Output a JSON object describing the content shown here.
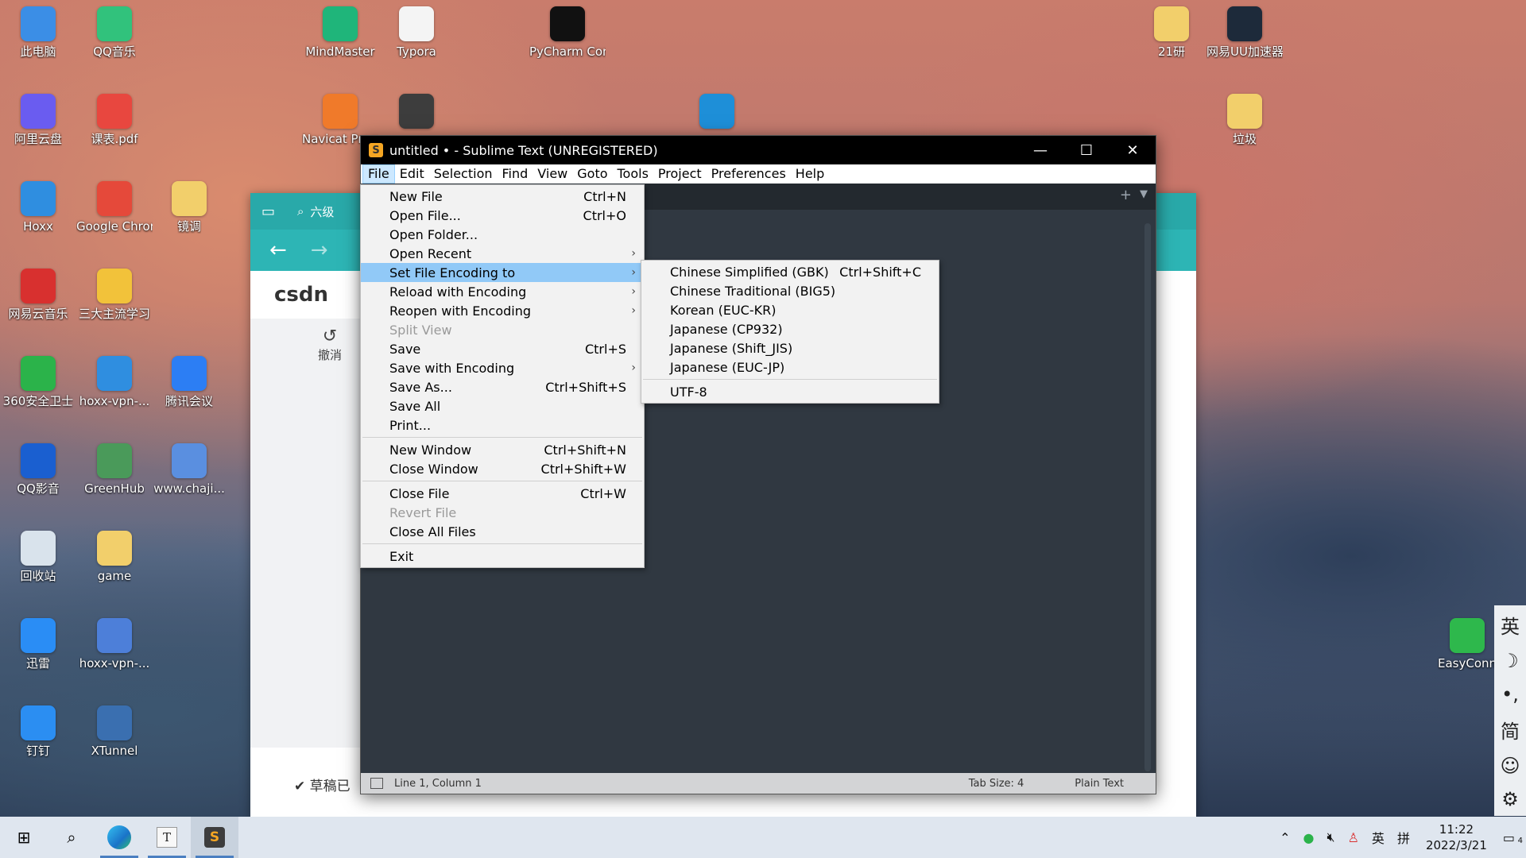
{
  "desktop": {
    "icons": [
      {
        "label": "此电脑",
        "icon": "computer-icon",
        "color": "#3b8ee6"
      },
      {
        "label": "QQ音乐",
        "icon": "qq-music-icon",
        "color": "#31c27c"
      },
      {
        "label": "MindMaster",
        "icon": "mindmaster-icon",
        "color": "#1fb57a"
      },
      {
        "label": "Typora",
        "icon": "typora-icon",
        "color": "#f4f4f4"
      },
      {
        "label": "PyCharm Communi...",
        "icon": "pycharm-icon",
        "color": "#111111"
      },
      {
        "label": "21研",
        "icon": "folder-icon",
        "color": "#f2cf6b"
      },
      {
        "label": "网易UU加速器",
        "icon": "uu-accelerator-icon",
        "color": "#1d2a3a"
      },
      {
        "label": "阿里云盘",
        "icon": "aliyun-drive-icon",
        "color": "#6a5cf0"
      },
      {
        "label": "课表.pdf",
        "icon": "pdf-icon",
        "color": "#e8473f"
      },
      {
        "label": "Navicat Premium",
        "icon": "navicat-icon",
        "color": "#f07a2a"
      },
      {
        "label": "",
        "icon": "sublime-icon",
        "color": "#3d3d3d"
      },
      {
        "label": "",
        "icon": "edge-icon",
        "color": "#1e8fd8"
      },
      {
        "label": "垃圾",
        "icon": "folder-icon",
        "color": "#f2cf6b"
      },
      {
        "label": "Hoxx",
        "icon": "hoxx-icon",
        "color": "#2f8ee0"
      },
      {
        "label": "Google Chrome",
        "icon": "chrome-icon",
        "color": "#e5493a"
      },
      {
        "label": "镜调",
        "icon": "folder-icon",
        "color": "#f2cf6b"
      },
      {
        "label": "网易云音乐",
        "icon": "netease-music-icon",
        "color": "#d8302f"
      },
      {
        "label": "三大主流学习",
        "icon": "archive-icon",
        "color": "#f2c23a"
      },
      {
        "label": "360安全卫士",
        "icon": "360-icon",
        "color": "#2bb34a"
      },
      {
        "label": "hoxx-vpn-...",
        "icon": "hoxx-icon",
        "color": "#2f8ee0"
      },
      {
        "label": "腾讯会议",
        "icon": "tencent-meeting-icon",
        "color": "#2c7ef4"
      },
      {
        "label": "QQ影音",
        "icon": "qq-player-icon",
        "color": "#1a5fd0"
      },
      {
        "label": "GreenHub",
        "icon": "greenhub-icon",
        "color": "#4a9a5a"
      },
      {
        "label": "www.chaji...",
        "icon": "archive-icon",
        "color": "#5a8fe0"
      },
      {
        "label": "回收站",
        "icon": "recycle-bin-icon",
        "color": "#d9e3ec"
      },
      {
        "label": "game",
        "icon": "folder-icon",
        "color": "#f2cf6b"
      },
      {
        "label": "迅雷",
        "icon": "thunder-icon",
        "color": "#2a8df5"
      },
      {
        "label": "hoxx-vpn-...",
        "icon": "archive-icon",
        "color": "#4d7fd9"
      },
      {
        "label": "钉钉",
        "icon": "dingtalk-icon",
        "color": "#2b8ef2"
      },
      {
        "label": "XTunnel",
        "icon": "xtunnel-icon",
        "color": "#3a6fb0"
      },
      {
        "label": "EasyConn",
        "icon": "easyconnect-icon",
        "color": "#2eb84c"
      }
    ]
  },
  "browser": {
    "search_text": "六级",
    "logo": "csdn",
    "undo_label": "撤消",
    "draft_text": "草稿已"
  },
  "sublime": {
    "title": "untitled • - Sublime Text (UNREGISTERED)",
    "menubar": [
      "File",
      "Edit",
      "Selection",
      "Find",
      "View",
      "Goto",
      "Tools",
      "Project",
      "Preferences",
      "Help"
    ],
    "status": {
      "position": "Line 1, Column 1",
      "tab_size": "Tab Size: 4",
      "syntax": "Plain Text"
    }
  },
  "file_menu": {
    "groups": [
      [
        {
          "label": "New File",
          "shortcut": "Ctrl+N"
        },
        {
          "label": "Open File...",
          "shortcut": "Ctrl+O"
        },
        {
          "label": "Open Folder...",
          "shortcut": ""
        },
        {
          "label": "Open Recent",
          "shortcut": "",
          "submenu": true
        },
        {
          "label": "Set File Encoding to",
          "shortcut": "",
          "submenu": true,
          "highlighted": true
        },
        {
          "label": "Reload with Encoding",
          "shortcut": "",
          "submenu": true
        },
        {
          "label": "Reopen with Encoding",
          "shortcut": "",
          "submenu": true
        },
        {
          "label": "Split View",
          "shortcut": "",
          "disabled": true
        },
        {
          "label": "Save",
          "shortcut": "Ctrl+S"
        },
        {
          "label": "Save with Encoding",
          "shortcut": "",
          "submenu": true
        },
        {
          "label": "Save As...",
          "shortcut": "Ctrl+Shift+S"
        },
        {
          "label": "Save All",
          "shortcut": ""
        },
        {
          "label": "Print...",
          "shortcut": ""
        }
      ],
      [
        {
          "label": "New Window",
          "shortcut": "Ctrl+Shift+N"
        },
        {
          "label": "Close Window",
          "shortcut": "Ctrl+Shift+W"
        }
      ],
      [
        {
          "label": "Close File",
          "shortcut": "Ctrl+W"
        },
        {
          "label": "Revert File",
          "shortcut": "",
          "disabled": true
        },
        {
          "label": "Close All Files",
          "shortcut": ""
        }
      ],
      [
        {
          "label": "Exit",
          "shortcut": ""
        }
      ]
    ]
  },
  "encoding_menu": {
    "items": [
      {
        "label": "Chinese Simplified (GBK)",
        "shortcut": "Ctrl+Shift+C"
      },
      {
        "label": "Chinese Traditional (BIG5)",
        "shortcut": ""
      },
      {
        "label": "Korean (EUC-KR)",
        "shortcut": ""
      },
      {
        "label": "Japanese (CP932)",
        "shortcut": ""
      },
      {
        "label": "Japanese (Shift_JIS)",
        "shortcut": ""
      },
      {
        "label": "Japanese (EUC-JP)",
        "shortcut": ""
      }
    ],
    "after_separator": [
      {
        "label": "UTF-8",
        "shortcut": ""
      }
    ]
  },
  "ime_panel": [
    "英",
    "☽",
    "•,",
    "简",
    "☺",
    "⚙"
  ],
  "taskbar": {
    "apps": [
      "start-icon",
      "search-icon",
      "edge-icon",
      "typora-icon",
      "sublime-icon"
    ],
    "tray": {
      "ime_lang": "英",
      "ime_mode": "拼",
      "time": "11:22",
      "date": "2022/3/21",
      "notification_count": "4"
    }
  }
}
